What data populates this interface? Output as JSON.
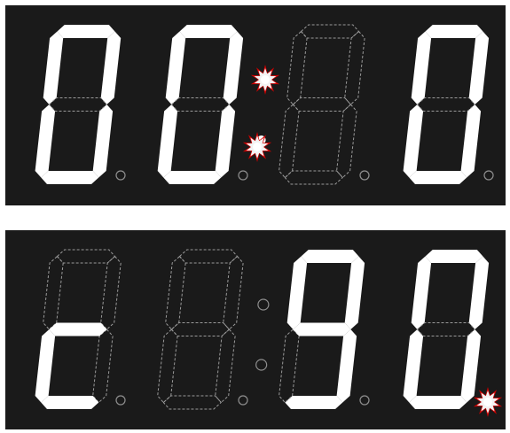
{
  "colors": {
    "page_bg": "#ffffff",
    "panel_bg": "#1a1a1a",
    "segment_on": "#ffffff",
    "segment_off_stroke": "#9a9a9a",
    "dot_off_stroke": "#8f8f8f",
    "burst_red": "#d40000",
    "burst_core": "#ffffff"
  },
  "icons": [
    "lit-colon-burst-icon",
    "lit-dp-burst-icon"
  ],
  "displays": [
    {
      "id": "top",
      "digits": [
        {
          "on": [
            "a",
            "b",
            "c",
            "d",
            "e",
            "f"
          ],
          "dp": false
        },
        {
          "on": [
            "a",
            "b",
            "c",
            "d",
            "e",
            "f"
          ],
          "dp": false
        },
        {
          "on": [],
          "dp": false
        },
        {
          "on": [
            "a",
            "b",
            "c",
            "d",
            "e",
            "f"
          ],
          "dp": false
        }
      ],
      "colon": {
        "upper": true,
        "lower": true
      },
      "burst": [
        "colon-upper",
        "colon-lower"
      ]
    },
    {
      "id": "bottom",
      "digits": [
        {
          "on": [
            "d",
            "e",
            "g"
          ],
          "dp": false
        },
        {
          "on": [],
          "dp": false
        },
        {
          "on": [
            "a",
            "b",
            "c",
            "d",
            "f",
            "g"
          ],
          "dp": false
        },
        {
          "on": [
            "a",
            "b",
            "c",
            "d",
            "e",
            "f"
          ],
          "dp": true
        }
      ],
      "colon": {
        "upper": false,
        "lower": false
      },
      "burst": [
        "dp-3"
      ]
    }
  ]
}
